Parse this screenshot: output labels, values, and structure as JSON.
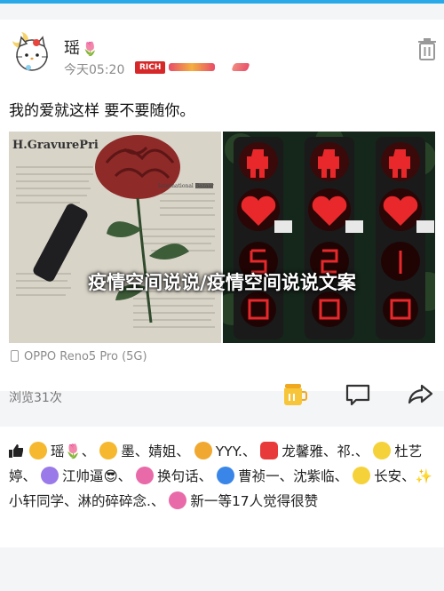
{
  "post": {
    "username": "瑶",
    "username_emoji": "🌷",
    "timestamp": "今天05:20",
    "badge_label": "RICH",
    "content": "我的爱就这样 要不要随你。",
    "image_left_newspaper_title": "H.GravurePri",
    "image_left_newspaper_sub": "International Bazaar",
    "overlay_title": "疫情空间说说/疫情空间说说文案",
    "device": "OPPO Reno5 Pro (5G)",
    "views": "浏览31次"
  },
  "likes": {
    "names": [
      {
        "name": "瑶🌷",
        "icon_color": "#f5b82e"
      },
      {
        "name": "墨",
        "icon_color": "#f5b82e"
      },
      {
        "name": "婧姐",
        "icon_color": "#f5b82e"
      },
      {
        "name": "YYY.",
        "icon_color": "#f0a830"
      },
      {
        "name": "龙馨雅",
        "icon_color": "#e83a3a"
      },
      {
        "name": "祁.",
        "icon_color": "#f5d23a"
      },
      {
        "name": "杜艺婷",
        "icon_color": "#f5d23a"
      },
      {
        "name": "江帅逼😎",
        "icon_color": "#9a7ae8"
      },
      {
        "name": "换句话",
        "icon_color": "#e86aa8"
      },
      {
        "name": "曹祯一",
        "icon_color": "#3a86e8"
      },
      {
        "name": "沈紫临",
        "icon_color": "#3a86e8"
      },
      {
        "name": "长安",
        "icon_color": "#f5d23a"
      },
      {
        "name": "✨小轩同学",
        "icon_color": "#f5d23a"
      },
      {
        "name": "淋的碎碎念.",
        "icon_color": "#f5d23a"
      },
      {
        "name": "新一",
        "icon_color": "#e86aa8"
      }
    ],
    "summary": "等17人觉得很赞"
  },
  "colors": {
    "accent": "#29a9e8",
    "badge_red": "#d62828",
    "muted": "#8b8b8b"
  },
  "icons": [
    "trash-icon",
    "honey-jar-icon",
    "comment-icon",
    "share-icon",
    "thumb-up-icon",
    "phone-icon"
  ]
}
